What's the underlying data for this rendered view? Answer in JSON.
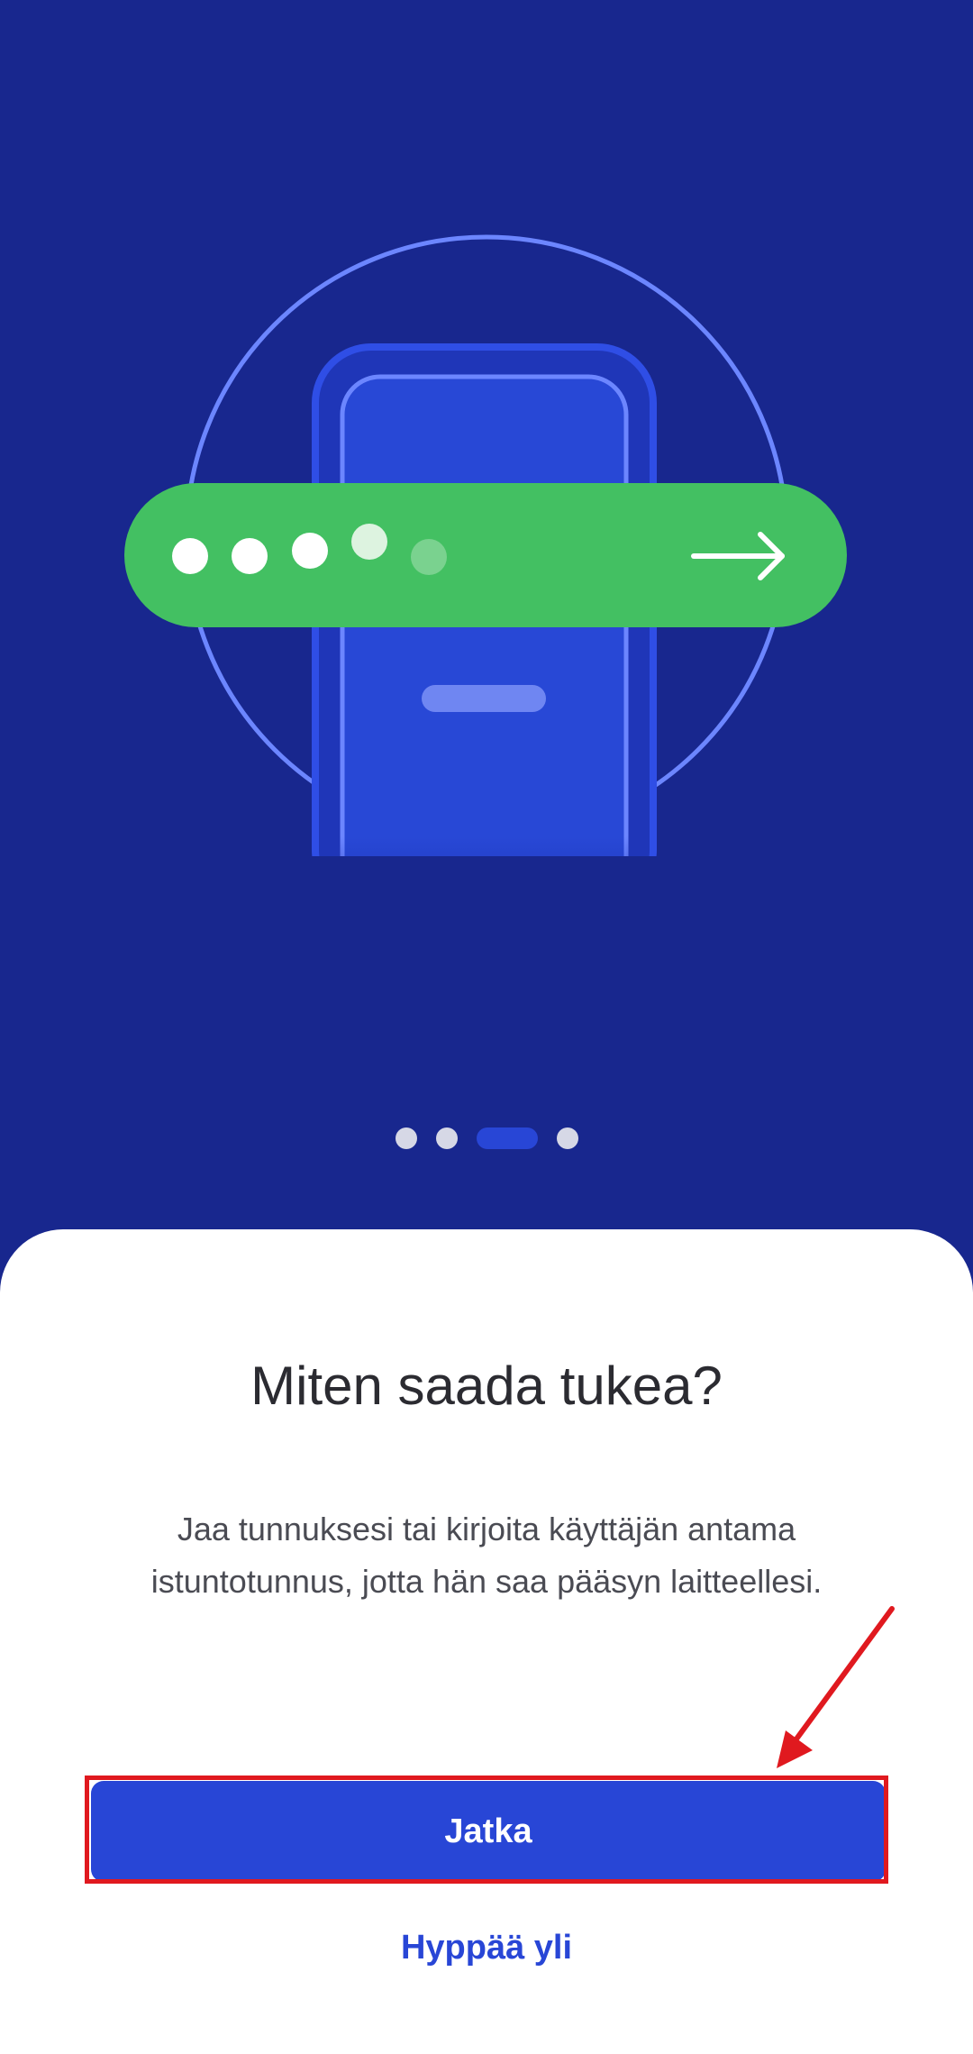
{
  "onboarding": {
    "title": "Miten saada tukea?",
    "description": "Jaa tunnuksesi tai kirjoita käyttäjän antama istuntotunnus, jotta hän saa pääsyn laitteellesi.",
    "primary_button_label": "Jatka",
    "skip_label": "Hyppää yli",
    "page_indicator": {
      "total": 4,
      "active_index": 2
    }
  },
  "illustration": {
    "subject": "phone with session-code bar",
    "icons": [
      "phone-icon",
      "code-dots-icon",
      "arrow-right-icon"
    ],
    "code_dots_filled": 4
  },
  "annotation": {
    "highlight_target": "primary-button",
    "pointer": "red-arrow"
  },
  "colors": {
    "background": "#18278e",
    "accent": "#2846d6",
    "green_bar": "#43c062",
    "sheet": "#ffffff",
    "highlight": "#e0191f"
  }
}
